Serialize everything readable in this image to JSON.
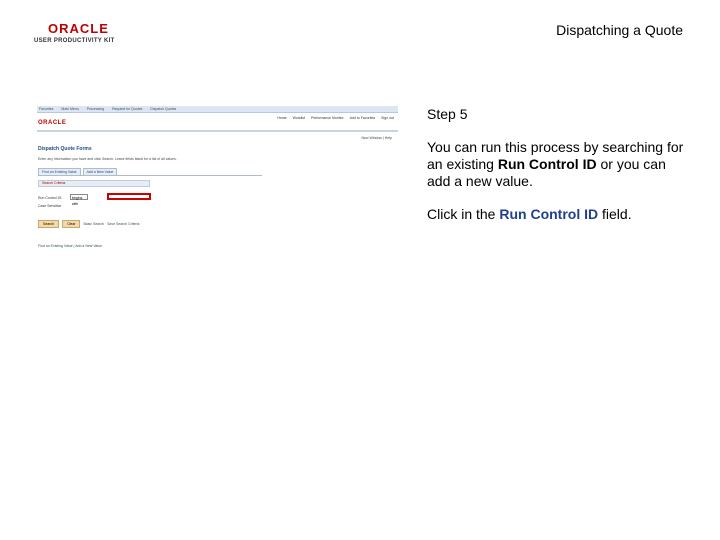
{
  "logo": {
    "brand": "ORACLE",
    "product": "USER PRODUCTIVITY KIT"
  },
  "doc_title": "Dispatching a Quote",
  "screenshot": {
    "topbar": [
      "Favorites",
      "Main Menu",
      "Processing",
      "Request for Quotes",
      "Dispatch Quotes"
    ],
    "nav": [
      "Home",
      "Worklist",
      "Performance Monitor",
      "Add to Favorites",
      "Sign out"
    ],
    "logo": "ORACLE",
    "subnav": "New Window | Help",
    "page_title": "Dispatch Quote Forms",
    "instructions": "Enter any information you have and click Search. Leave fields blank for a list of all values.",
    "tabs": [
      "Find an Existing Value",
      "Add a New Value"
    ],
    "search_criteria": "Search Criteria",
    "run_control_label": "Run Control ID:",
    "run_control_value": "begins with",
    "case_sensitive": "Case Sensitive",
    "buttons": [
      "Search",
      "Clear"
    ],
    "links": [
      "Basic Search",
      "Save Search Criteria"
    ],
    "footer": "Find an Existing Value | Add a New Value"
  },
  "content": {
    "step": "Step 5",
    "para1_pre": "You can run this process by searching for an existing ",
    "para1_kw": "Run Control ID",
    "para1_post": " or you can add a new value.",
    "para2_pre": "Click in the ",
    "para2_kw": "Run Control ID",
    "para2_post": " field."
  },
  "colors": {
    "highlight": "#cc0000",
    "oracle_red": "#c00000",
    "keyword_blue": "#1f3f8f"
  }
}
